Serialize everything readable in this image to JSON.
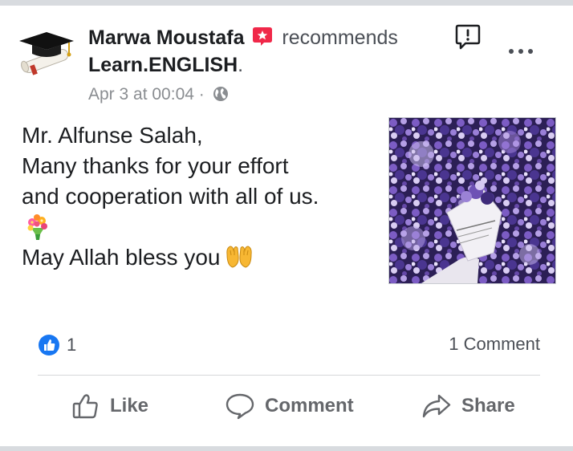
{
  "post": {
    "author": "Marwa Moustafa",
    "verb": "recommends",
    "page": "Learn.ENGLISH",
    "page_suffix": ".",
    "timestamp": "Apr 3 at 00:04",
    "separator": "·",
    "audience_icon": "globe-icon",
    "body": {
      "line1": "Mr. Alfunse Salah,",
      "line2": "Many thanks for your effort",
      "line3": "and cooperation with all of us.",
      "line4": "May Allah bless you"
    }
  },
  "summary": {
    "reaction_count": "1",
    "comment_count": "1 Comment"
  },
  "actions": {
    "like": "Like",
    "comment": "Comment",
    "share": "Share"
  },
  "colors": {
    "accent_blue": "#1877f2",
    "recommend_red": "#f02849",
    "muted_text": "#65676b"
  }
}
